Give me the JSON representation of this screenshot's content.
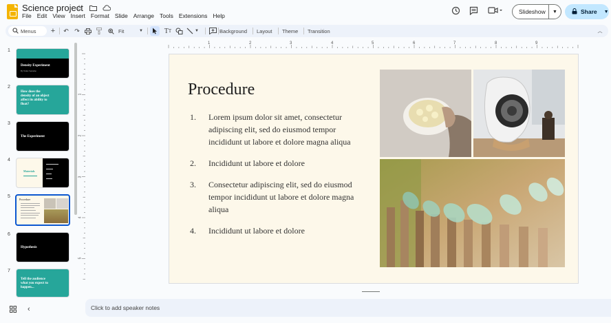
{
  "app": {
    "doc_title": "Science project",
    "menu": [
      "File",
      "Edit",
      "View",
      "Insert",
      "Format",
      "Slide",
      "Arrange",
      "Tools",
      "Extensions",
      "Help"
    ],
    "slideshow_label": "Slideshow",
    "share_label": "Share"
  },
  "toolbar": {
    "menus_label": "Menus",
    "zoom_label": "Fit",
    "background_label": "Background",
    "layout_label": "Layout",
    "theme_label": "Theme",
    "transition_label": "Transition"
  },
  "slides": [
    {
      "num": "1",
      "title": "Density Experiment",
      "subtitle": "By Name Surname"
    },
    {
      "num": "2",
      "title": "How does the density of an object affect its ability to float?"
    },
    {
      "num": "3",
      "title": "The Experiment"
    },
    {
      "num": "4",
      "title": "Materials"
    },
    {
      "num": "5",
      "title": "Procedure"
    },
    {
      "num": "6",
      "title": "Hypothesis"
    },
    {
      "num": "7",
      "title": "Tell the audience what you expect to happen..."
    }
  ],
  "ruler": {
    "h_labels": [
      "1",
      "2",
      "3",
      "4",
      "5",
      "6",
      "7",
      "8",
      "9"
    ],
    "v_labels": [
      "1",
      "2",
      "3",
      "4",
      "5"
    ]
  },
  "current_slide": {
    "title": "Procedure",
    "items": [
      {
        "num": "1.",
        "text": "Lorem ipsum dolor sit amet, consectetur adipiscing elit, sed do eiusmod tempor incididunt ut labore et dolore magna aliqua"
      },
      {
        "num": "2.",
        "text": "Incididunt ut labore et dolore"
      },
      {
        "num": "3.",
        "text": "Consectetur adipiscing elit, sed do eiusmod tempor incididunt ut labore et dolore magna aliqua"
      },
      {
        "num": "4.",
        "text": "Incididunt ut labore et dolore"
      }
    ]
  },
  "speaker_notes_placeholder": "Click to add speaker notes",
  "colors": {
    "teal": "#26a69a",
    "black": "#000000",
    "slide_bg": "#fdf8ea",
    "accent_blue": "#0b57d0",
    "share_bg": "#c2e7ff"
  }
}
